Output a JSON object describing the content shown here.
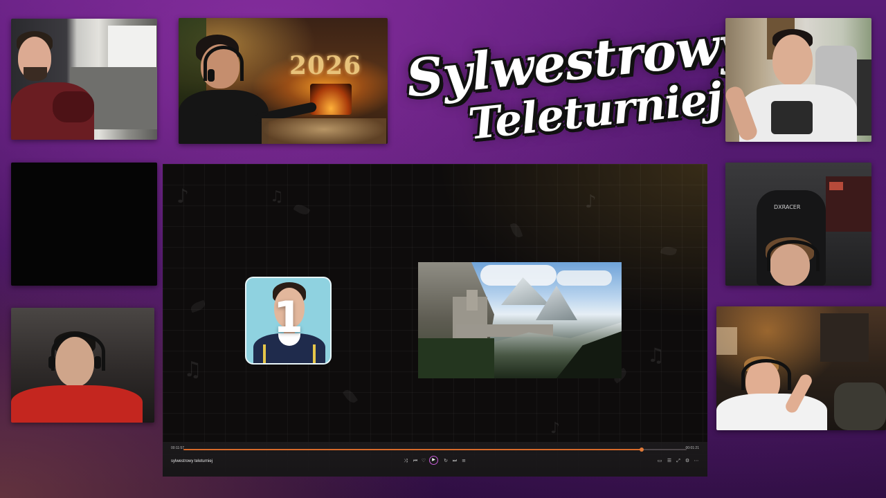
{
  "logo": {
    "line1": "Sylwestrowy",
    "line2": "Teleturniej"
  },
  "decor_2026": "2026",
  "player": {
    "track_title": "sylwestrowy teleturniej",
    "time_current": "00:11:57",
    "time_total": "00:01:21",
    "progress": 0.91,
    "contestant_number": "1",
    "icons": {
      "shuffle": "shuffle-icon",
      "previous": "previous-icon",
      "heart": "heart-icon",
      "play": "play-icon",
      "repeat": "repeat-icon",
      "next": "next-icon",
      "queue": "queue-icon",
      "cast": "cast-icon",
      "list": "list-icon",
      "fullscreen": "fullscreen-icon",
      "settings": "settings-icon",
      "more": "more-icon"
    }
  },
  "colors": {
    "background_purple": "#4a1766",
    "progress_accent": "#d86a2a",
    "play_ring": "#c75ad8"
  }
}
